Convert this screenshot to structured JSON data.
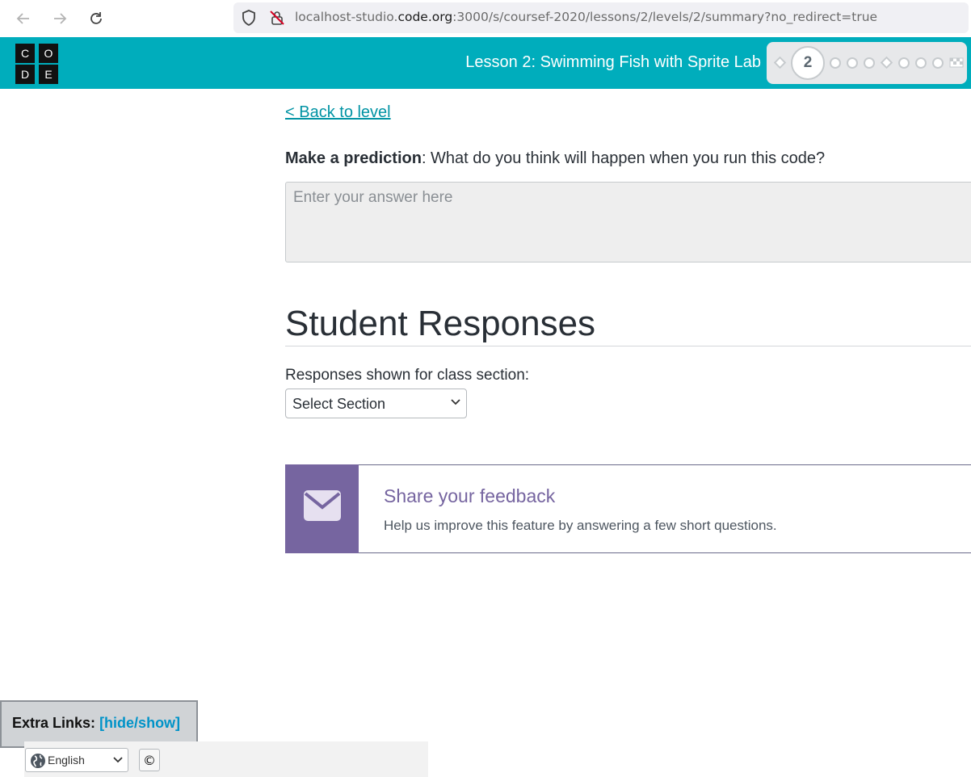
{
  "browser": {
    "url_prefix": "localhost-studio.",
    "url_host": "code.org",
    "url_suffix": ":3000/s/coursef-2020/lessons/2/levels/2/summary?no_redirect=true"
  },
  "header": {
    "logo_letters": [
      "C",
      "O",
      "D",
      "E"
    ],
    "lesson_title": "Lesson 2: Swimming Fish with Sprite Lab",
    "current_level": "2",
    "brand_color": "#00adbc"
  },
  "main": {
    "back_link": "< Back to level",
    "prompt_bold": "Make a prediction",
    "prompt_rest": ": What do you think will happen when you run this code?",
    "answer_placeholder": "Enter your answer here",
    "section_title": "Student Responses",
    "responses_label": "Responses shown for class section:",
    "section_select_value": "Select Section"
  },
  "feedback": {
    "title": "Share your feedback",
    "body": "Help us improve this feature by answering a few short questions.",
    "accent_color": "#7665a0"
  },
  "footer": {
    "extra_links_label": "Extra Links:",
    "extra_links_toggle": "[hide/show]",
    "language_value": "English",
    "copyright_symbol": "©"
  }
}
